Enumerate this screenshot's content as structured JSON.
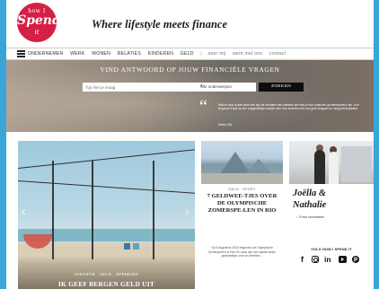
{
  "logo": {
    "line1": "how I",
    "line2": "Spend",
    "line3": "it"
  },
  "header": {
    "tagline": "Where lifestyle meets finance"
  },
  "nav": {
    "items": [
      "ONDERNEMEN",
      "WERK",
      "WONEN",
      "RELATIES",
      "KINDEREN",
      "GELD"
    ],
    "separator": "|",
    "extra": [
      "over mij",
      "werk met ons",
      "contact"
    ]
  },
  "banner": {
    "title": "VIND ANTWOORD OP JOUW FINANCIËLE VRAGEN",
    "search_placeholder": "Typ hier je vraag",
    "category_selected": "Alle onderwerpen",
    "search_button": "ZOEKEN",
    "quote_text": "Wat zo leuk is aan deze site zijn de verhalen van mensen die echt in hun financiën geïnteresseerd zijn. Hoe ik spend it laat op een toegankelijke manier zien hoe anderen met hun geld omgaan en dat geeft inspiratie.",
    "quote_author": "Dieke (29)"
  },
  "cards": {
    "feature": {
      "meta": "VAKANTIE · GELD · SPENDING",
      "title": "IK GEEF BERGEN GELD UIT"
    },
    "rio": {
      "meta": "GELD · SPORT",
      "title": "7 GELDWEE-TJES OVER DE OLYMPISCHE ZOMERSPE-LEN IN RIO",
      "text": "Op 5 augustus 2016 beginnen de Olympische Zomerspelen in Rio! En daar zijn een aantal leuke geldweetjes over te vertellen..."
    },
    "profile": {
      "name_line1": "Joëlla &",
      "name_line2": "Nathalie",
      "link": "Even voorstellen",
      "follow_label": "VOLG HOW I SPEND IT"
    }
  },
  "icons": [
    "hamburger-icon",
    "search-chevron-icon",
    "quote-icon",
    "facebook-icon",
    "instagram-icon",
    "linkedin-icon",
    "youtube-icon",
    "pinterest-icon"
  ],
  "colors": {
    "brand": "#d61f44",
    "frame": "#3aa5d8",
    "button": "#0d0d0d"
  }
}
